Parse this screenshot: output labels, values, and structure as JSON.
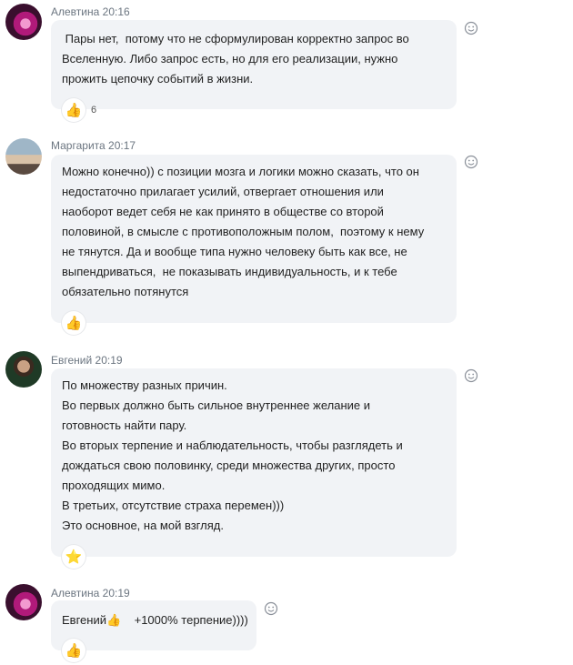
{
  "messages": [
    {
      "author": "Алевтина",
      "time": "20:16",
      "lines": [
        " Пары нет,  потому что не сформулирован корректно запрос во",
        "Вселенную. Либо запрос есть, но для его реализации, нужно",
        "прожить цепочку событий в жизни."
      ],
      "reaction": {
        "icon": "thumbs-up",
        "glyph": "👍",
        "count": "6"
      }
    },
    {
      "author": "Маргарита",
      "time": "20:17",
      "lines": [
        "Можно конечно)) с позиции мозга и логики можно сказать, что он",
        "недостаточно прилагает усилий, отвергает отношения или",
        "наоборот ведет себя не как принято в обществе со второй",
        "половиной, в смысле с противоположным полом,  поэтому к нему",
        "не тянутся. Да и вообще типа нужно человеку быть как все, не",
        "выпендриваться,  не показывать индивидуальность, и к тебе",
        "обязательно потянутся"
      ],
      "reaction": {
        "icon": "thumbs-up",
        "glyph": "👍",
        "count": ""
      }
    },
    {
      "author": "Евгений",
      "time": "20:19",
      "lines": [
        "По множеству разных причин.",
        "Во первых должно быть сильное внутреннее желание и",
        "готовность найти пару.",
        "Во вторых терпение и наблюдательность, чтобы разглядеть и",
        "дождаться свою половинку, среди множества других, просто",
        "проходящих мимо.",
        "В третьих, отсутствие страха перемен)))",
        "Это основное, на мой взгляд."
      ],
      "reaction": {
        "icon": "star",
        "glyph": "⭐",
        "count": ""
      }
    },
    {
      "author": "Алевтина",
      "time": "20:19",
      "lines": [
        "Евгений👍    +1000% терпение))))"
      ],
      "reaction": {
        "icon": "thumbs-up",
        "glyph": "👍",
        "count": ""
      }
    }
  ],
  "icons": {
    "add_reaction": "smiley-icon"
  }
}
